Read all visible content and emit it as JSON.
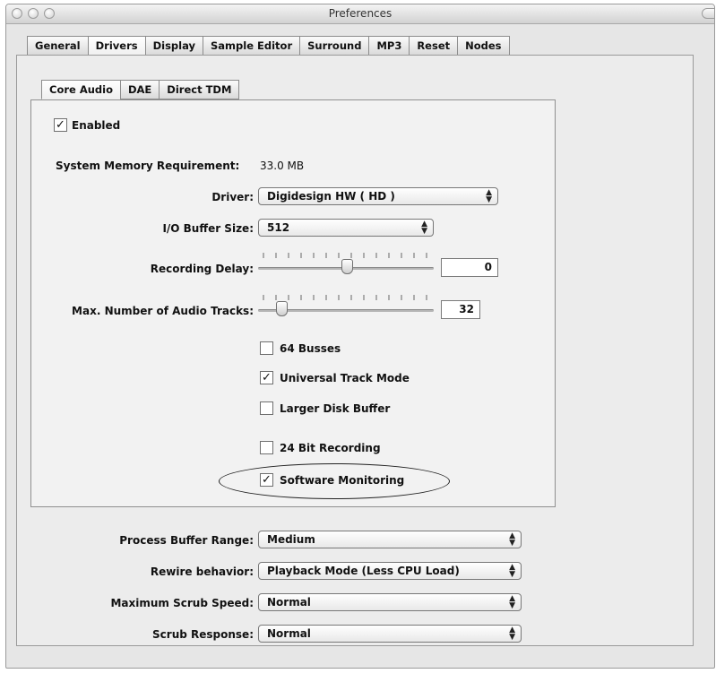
{
  "window": {
    "title": "Preferences"
  },
  "main_tabs": [
    "General",
    "Drivers",
    "Display",
    "Sample Editor",
    "Surround",
    "MP3",
    "Reset",
    "Nodes"
  ],
  "sub_tabs": [
    "Core Audio",
    "DAE",
    "Direct TDM"
  ],
  "core_audio": {
    "enabled": {
      "label": "Enabled",
      "checked": true
    },
    "memory": {
      "label": "System Memory Requirement:",
      "value": "33.0 MB"
    },
    "driver": {
      "label": "Driver:",
      "value": "Digidesign HW ( HD )"
    },
    "io_buffer": {
      "label": "I/O Buffer Size:",
      "value": "512"
    },
    "recording_delay": {
      "label": "Recording Delay:",
      "value": "0"
    },
    "max_tracks": {
      "label": "Max. Number of Audio Tracks:",
      "value": "32"
    },
    "options": [
      {
        "label": "64 Busses",
        "checked": false
      },
      {
        "label": "Universal Track Mode",
        "checked": true
      },
      {
        "label": "Larger Disk Buffer",
        "checked": false
      },
      {
        "label": "24 Bit Recording",
        "checked": false
      },
      {
        "label": "Software Monitoring",
        "checked": true
      }
    ]
  },
  "global": {
    "process_buffer_range": {
      "label": "Process Buffer Range:",
      "value": "Medium"
    },
    "rewire_behavior": {
      "label": "Rewire behavior:",
      "value": "Playback Mode (Less CPU Load)"
    },
    "max_scrub_speed": {
      "label": "Maximum Scrub Speed:",
      "value": "Normal"
    },
    "scrub_response": {
      "label": "Scrub Response:",
      "value": "Normal"
    }
  },
  "check_glyph": "✓",
  "popup_arrows": "▲▼"
}
